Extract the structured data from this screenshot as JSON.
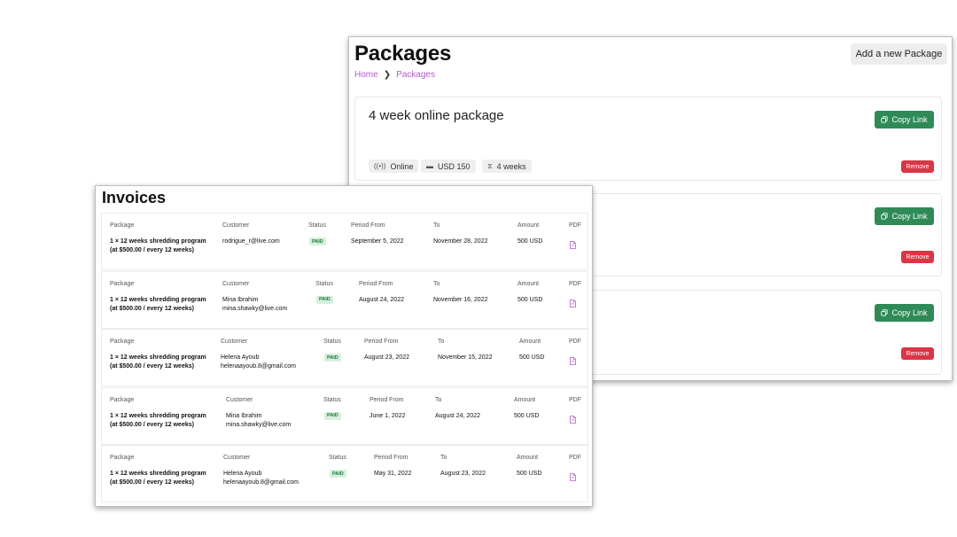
{
  "packages": {
    "title": "Packages",
    "add_button": "Add a new Package",
    "breadcrumb": [
      "Home",
      "Packages"
    ],
    "copy_label": "Copy Link",
    "remove_label": "Remove",
    "cards": [
      {
        "name": "4 week online package",
        "chips": [
          "Online",
          "USD 150",
          "4 weeks"
        ]
      },
      {
        "name": ""
      },
      {
        "name": ""
      }
    ]
  },
  "invoices": {
    "title": "Invoices",
    "headers": {
      "package": "Package",
      "customer": "Customer",
      "status": "Status",
      "period_from": "Period From",
      "to": "To",
      "amount": "Amount",
      "pdf": "PDF"
    },
    "rows": [
      {
        "package": "1 × 12 weeks shredding program (at $500.00 / every 12 weeks)",
        "customer_name": "",
        "customer_email": "rodrigue_r@live.com",
        "status": "PAID",
        "period_from": "September 5, 2022",
        "to": "November 28, 2022",
        "amount": "500 USD"
      },
      {
        "package": "1 × 12 weeks shredding program (at $500.00 / every 12 weeks)",
        "customer_name": "Mina Ibrahim",
        "customer_email": "mina.shawky@live.com",
        "status": "PAID",
        "period_from": "August 24, 2022",
        "to": "November 16, 2022",
        "amount": "500 USD"
      },
      {
        "package": "1 × 12 weeks shredding program (at $500.00 / every 12 weeks)",
        "customer_name": "Helena Ayoub",
        "customer_email": "helenaayoub.8@gmail.com",
        "status": "PAID",
        "period_from": "August 23, 2022",
        "to": "November 15, 2022",
        "amount": "500 USD"
      },
      {
        "package": "1 × 12 weeks shredding program (at $500.00 / every 12 weeks)",
        "customer_name": "Mina Ibrahim",
        "customer_email": "mina.shawky@live.com",
        "status": "PAID",
        "period_from": "June 1, 2022",
        "to": "August 24, 2022",
        "amount": "500 USD"
      },
      {
        "package": "1 × 12 weeks shredding program (at $500.00 / every 12 weeks)",
        "customer_name": "Helena Ayoub",
        "customer_email": "helenaayoub.8@gmail.com",
        "status": "PAID",
        "period_from": "May 31, 2022",
        "to": "August 23, 2022",
        "amount": "500 USD"
      }
    ]
  },
  "icons": {
    "online": "broadcast-icon",
    "price": "cash-icon",
    "duration": "hourglass-icon",
    "copy": "copy-icon",
    "pdf": "file-pdf-icon"
  },
  "colors": {
    "breadcrumb_link": "#b45bcf",
    "copy_button": "#2e8b57",
    "remove_button": "#dc3545",
    "paid_badge_bg": "#d5f0dc",
    "paid_badge_text": "#1f7a3a",
    "pdf_icon": "#b45bcf"
  }
}
